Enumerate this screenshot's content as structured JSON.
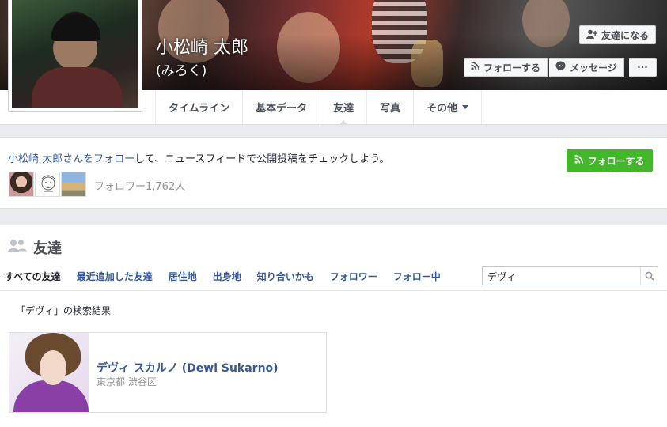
{
  "profile": {
    "name": "小松崎 太郎",
    "alternate_name": "(みろく)"
  },
  "actions": {
    "add_friend": "友達になる",
    "follow": "フォローする",
    "message": "メッセージ",
    "more": "···"
  },
  "tabs": [
    {
      "label": "タイムライン"
    },
    {
      "label": "基本データ"
    },
    {
      "label": "友達"
    },
    {
      "label": "写真"
    },
    {
      "label": "その他"
    }
  ],
  "follow_prompt": {
    "link_text": "小松崎 太郎さんをフォロー",
    "rest_text": "して、ニュースフィードで公開投稿をチェックしよう。",
    "button": "フォローする",
    "follower_count": "フォロワー1,762人"
  },
  "friends": {
    "title": "友達",
    "subtabs": [
      {
        "label": "すべての友達"
      },
      {
        "label": "最近追加した友達"
      },
      {
        "label": "居住地"
      },
      {
        "label": "出身地"
      },
      {
        "label": "知り合いかも"
      },
      {
        "label": "フォロワー"
      },
      {
        "label": "フォロー中"
      }
    ],
    "search": {
      "value": "デヴィ"
    },
    "results_label": "「デヴィ」の検索結果",
    "results": [
      {
        "name": "デヴィ スカルノ (Dewi Sukarno)",
        "location": "東京都 渋谷区"
      }
    ]
  },
  "colors": {
    "link": "#365899",
    "green": "#42b72a",
    "page_bg": "#e9ebee"
  }
}
